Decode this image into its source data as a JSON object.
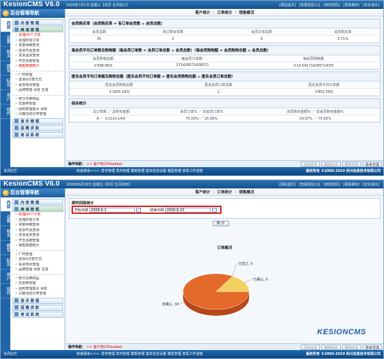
{
  "app": {
    "title": "KesionCMS V6.0",
    "top_links": [
      "[网站首页]",
      "[查看短信(1)]",
      "[修改密码]",
      "[更新缓存]",
      "[安全退出]"
    ],
    "nav_title": "后台管理导航",
    "footer_quick": "快速通道<<<: 发布管理  发布管理  模板管理  基本信息设置  模型管理  查看工作进度",
    "footer_copyright": "版权所有 ©2006-2010 科兴信息技术有限公司",
    "footer_left": "关闭左栏"
  },
  "shot1": {
    "date_text": "2009年7月1日 星期三【农历 五月初九】",
    "vtabs": [
      "内容",
      "设置",
      "相关",
      "模型",
      "标签",
      "用户",
      "插件"
    ],
    "menu": [
      {
        "type": "head",
        "label": "内 容 管 理"
      },
      {
        "type": "head",
        "label": "商 城 管 理",
        "active": true
      },
      {
        "type": "item",
        "label": "处理(4)个订单",
        "red": true
      },
      {
        "type": "item",
        "label": "处理所有订单"
      },
      {
        "type": "item",
        "label": "资金明细查询"
      },
      {
        "type": "item",
        "label": "发票开具查询"
      },
      {
        "type": "item",
        "label": "发货退货查询"
      },
      {
        "type": "item",
        "label": "开支票据管理"
      },
      {
        "type": "item",
        "label": "销售数据统计",
        "red": true
      },
      {
        "type": "sep"
      },
      {
        "type": "item",
        "label": "厂商管理"
      },
      {
        "type": "item",
        "label": "送货&付款方式"
      },
      {
        "type": "item",
        "label": "看货地点管理"
      },
      {
        "type": "item",
        "label": "品牌管理 添加 生成"
      },
      {
        "type": "sep"
      },
      {
        "type": "item",
        "label": "积分兑换商品"
      },
      {
        "type": "item",
        "label": "优惠券管理"
      },
      {
        "type": "item",
        "label": "团购管理首页 添加"
      },
      {
        "type": "item",
        "label": "兴趣活动分类管理"
      },
      {
        "type": "head",
        "label": "音 乐 管 理"
      },
      {
        "type": "head",
        "label": "招 聘 求 职"
      },
      {
        "type": "head",
        "label": "考 试 系 统"
      }
    ],
    "tabs": [
      "客户统计",
      "订单统计",
      "销售概况"
    ],
    "panels": [
      {
        "title": "会员购买率（会员购买率 = 有订单会员数 ÷ 会员总数）",
        "headers": [
          "会员总数",
          "有订单会员数",
          "会员订单总数",
          "会员购买率"
        ],
        "values": [
          "35",
          "2",
          "6",
          "5.71%"
        ]
      },
      {
        "title": "每会员平均订单数及购物额（每会员订单数 = 会员订单总数 ÷ 会员总数）（每会员购物额 = 会员购物总额 ÷ 会员总数）",
        "headers": [
          "会员购物总额",
          "每会员订单数",
          "每会员购物额"
        ],
        "values": [
          "￥508.96元",
          ".171428571428571",
          "￥14.5417142857143元"
        ]
      },
      {
        "title": "匿名会员平均订单额及购物总额（匿名会员平均订单额 = 匿名会员购物总额 ÷ 匿名会员订单总数）",
        "headers": [
          "匿名会员购物总额",
          "匿名会员订单总数",
          "匿名会员平均订单额"
        ],
        "values": [
          "￥1605.18元",
          "2",
          "￥802.59元"
        ]
      },
      {
        "title": "综合统计",
        "headers": [
          "总订单数 ／ 总购买金额",
          "会员订单% ／ 非会员订单%",
          "会员购买金额% ／ 非会员购买金额%"
        ],
        "values": [
          "8 ／ ￥2114.14元",
          "75.00% ／ 25.00%",
          "24.07% ／ 75.93%"
        ]
      }
    ],
    "opbar": {
      "label": "操作导航：",
      "path": ">> 客户统计Disabled"
    },
    "buttons": [
      "添加信息",
      "编辑信息",
      "删除信息",
      "技术交流"
    ]
  },
  "shot2": {
    "date_text": "2009年6月26日 星期五【农历 五月初四】",
    "vtabs": [
      "内容",
      "设置",
      "相关",
      "模型",
      "标签",
      "用户",
      "插件"
    ],
    "menu": [
      {
        "type": "head",
        "label": "内 容 管 理"
      },
      {
        "type": "head",
        "label": "商 城 管 理",
        "active": true
      },
      {
        "type": "item",
        "label": "处理(4)个订单",
        "red": true
      },
      {
        "type": "item",
        "label": "处理所有订单"
      },
      {
        "type": "item",
        "label": "资金明细查询"
      },
      {
        "type": "item",
        "label": "发票开具查询"
      },
      {
        "type": "item",
        "label": "发货退货查询"
      },
      {
        "type": "item",
        "label": "开支票据管理"
      },
      {
        "type": "item",
        "label": "销售数据统计"
      },
      {
        "type": "sep"
      },
      {
        "type": "item",
        "label": "厂商管理"
      },
      {
        "type": "item",
        "label": "送货&付款方式"
      },
      {
        "type": "item",
        "label": "看货地点管理"
      },
      {
        "type": "item",
        "label": "品牌管理 添加 生成"
      },
      {
        "type": "sep"
      },
      {
        "type": "item",
        "label": "积分兑换商品"
      },
      {
        "type": "item",
        "label": "优惠券管理"
      },
      {
        "type": "item",
        "label": "团购管理首页 添加"
      },
      {
        "type": "item",
        "label": "兴趣活动分类管理"
      },
      {
        "type": "head",
        "label": "音 乐 管 理"
      },
      {
        "type": "head",
        "label": "招 聘 求 职"
      },
      {
        "type": "head",
        "label": "考 试 系 统"
      }
    ],
    "tabs": [
      "客户统计",
      "订单统计",
      "销售概况"
    ],
    "time_panel_title": "按时间段统计",
    "start_label": "开始日期",
    "start_value": "2009-6-1",
    "end_label": "结束日期",
    "end_value": "2009-6-25",
    "stat_button": "统 计",
    "chart_title": "订单概况",
    "brand": "KESIONCMS",
    "opbar": {
      "label": "操作导航：",
      "path": ">> 客户统计Disabled"
    },
    "buttons": [
      "添加信息",
      "编辑信息",
      "删除信息",
      "技术交流"
    ]
  },
  "chart_data": {
    "type": "pie",
    "title": "订单概况",
    "categories": [
      "已成立",
      "已确认",
      "未确认"
    ],
    "values": [
      0,
      6,
      30
    ],
    "labels": [
      "已成立, 0",
      "已确认, 6",
      "未确认, 30"
    ],
    "colors": [
      "#f0a020",
      "#f3d060",
      "#e46a2a"
    ]
  }
}
